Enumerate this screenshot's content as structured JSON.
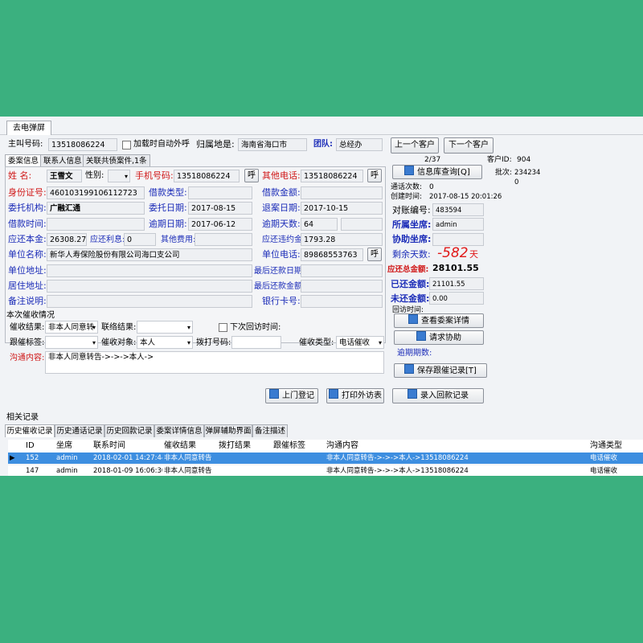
{
  "window": {
    "tab_title": "去电弹屏"
  },
  "header": {
    "main_number_label": "主叫号码:",
    "main_number": "13518086224",
    "auto_call_label": "加载时自动外呼",
    "location_label": "归属地是:",
    "location": "海南省海口市",
    "team_label": "团队:",
    "team": "总经办",
    "prev_button": "上一个客户",
    "next_button": "下一个客户"
  },
  "subtabs": [
    "委案信息",
    "联系人信息",
    "关联共债案件,1条"
  ],
  "case": {
    "name_label": "姓 名:",
    "name": "王雪文",
    "gender_label": "性别:",
    "gender": "",
    "mobile_label": "手机号码:",
    "mobile": "13518086224",
    "other_phone_label": "其他电话:",
    "other_phone": "13518086224",
    "call_button": "呼",
    "id_label": "身份证号:",
    "id_number": "460103199106112723",
    "loan_type_label": "借款类型:",
    "loan_type": "",
    "loan_amount_label": "借款金额:",
    "loan_amount": "",
    "agency_label": "委托机构:",
    "agency": "广融汇通",
    "entrust_date_label": "委托日期:",
    "entrust_date": "2017-08-15",
    "return_date_label": "退案日期:",
    "return_date": "2017-10-15",
    "loan_time_label": "借款时间:",
    "loan_time": "",
    "overdue_date_label": "逾期日期:",
    "overdue_date": "2017-06-12",
    "overdue_days_label": "逾期天数:",
    "overdue_days": "64",
    "principal_label": "应还本金:",
    "principal": "26308.27",
    "interest_label": "应还利息:",
    "interest": "0",
    "other_fee_label": "其他费用:",
    "other_fee": "",
    "penalty_label": "应还违约金:",
    "penalty": "1793.28",
    "employer_label": "单位名称:",
    "employer": "新华人寿保险股份有限公司海口支公司",
    "employer_phone_label": "单位电话:",
    "employer_phone": "89868553763",
    "employer_address_label": "单位地址:",
    "employer_address": "",
    "last_repay_date_label": "最后还款日期:",
    "last_repay_date": "",
    "home_address_label": "居住地址:",
    "home_address": "",
    "last_repay_amount_label": "最后还款金额:",
    "last_repay_amount": "",
    "remark_label": "备注说明:",
    "remark": "",
    "bank_card_label": "银行卡号:",
    "bank_card": ""
  },
  "right": {
    "info_query_button": "信息库查询[Q]",
    "page": "2/37",
    "customer_id_label": "客户ID:",
    "customer_id": "904",
    "batch_label": "批次:",
    "batch": "234234",
    "batch_extra": "0",
    "call_count_label": "通话次数:",
    "call_count": "0",
    "create_time_label": "创建时间:",
    "create_time": "2017-08-15 20:01:26",
    "account_no_label": "对账编号:",
    "account_no": "483594",
    "seat_label": "所属坐席:",
    "seat": "admin",
    "assist_label": "协助坐席:",
    "assist": "",
    "remaining_days_label": "剩余天数:",
    "remaining_days": "-582",
    "remaining_days_unit": "天",
    "total_due_label": "应还总金额:",
    "total_due": "28101.55",
    "repaid_label": "已还金额:",
    "repaid": "21101.55",
    "unpaid_label": "未还金额:",
    "unpaid": "0.00",
    "callback_time_label": "回访时间:",
    "view_details_button": "查看委案详情",
    "request_help_button": "请求协助",
    "overdue_periods_label": "逾期期数:",
    "save_record_button": "保存跟催记录[T]"
  },
  "collection": {
    "section_title": "本次催收情况",
    "result_label": "催收结果:",
    "result": "非本人同意转",
    "contact_result_label": "联络结果:",
    "contact_result": "",
    "next_callback_label": "下次回访时间:",
    "tag_label": "跟催标签:",
    "tag": "",
    "target_label": "催收对象:",
    "target": "本人",
    "dial_number_label": "拨打号码:",
    "dial_number": "",
    "type_label": "催收类型:",
    "type": "电话催收",
    "content_label": "沟通内容:",
    "content": "非本人同意转告->->->本人->"
  },
  "actions": {
    "visit_button": "上门登记",
    "print_button": "打印外访表",
    "payment_button": "录入回款记录"
  },
  "related": {
    "title": "相关记录",
    "tabs": [
      "历史催收记录",
      "历史通话记录",
      "历史回款记录",
      "委案详情信息",
      "弹屏辅助界面",
      "备注描述"
    ],
    "columns": [
      "ID",
      "坐席",
      "联系时间",
      "催收结果",
      "拨打结果",
      "跟催标签",
      "沟通内容",
      "沟通类型"
    ],
    "rows": [
      [
        "152",
        "admin",
        "2018-02-01 14:27:44",
        "非本人同意转告",
        "",
        "",
        "非本人同意转告->->->本人->13518086224",
        "电话催收"
      ],
      [
        "147",
        "admin",
        "2018-01-09 16:06:30",
        "非本人同意转告",
        "",
        "",
        "非本人同意转告->->->本人->13518086224",
        "电话催收"
      ]
    ]
  },
  "colors": {
    "background": "#3bb07f",
    "selected_row": "#3d8ee0",
    "label_blue": "#1c2db8",
    "label_red": "#d01818"
  }
}
